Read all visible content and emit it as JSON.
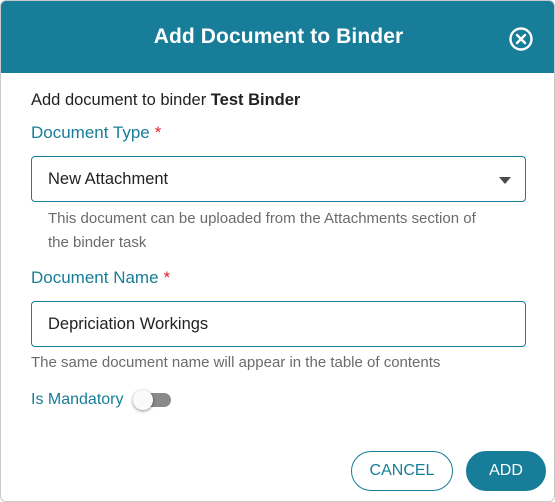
{
  "dialog": {
    "title": "Add Document to Binder",
    "intro_prefix": "Add document to binder ",
    "binder_name": "Test Binder"
  },
  "document_type": {
    "label": "Document Type",
    "required_marker": "*",
    "selected_value": "New Attachment",
    "hint": "This document can be uploaded from the Attachments section of the binder task"
  },
  "document_name": {
    "label": "Document Name",
    "required_marker": "*",
    "value": "Depriciation Workings",
    "hint": "The same document name will appear in the table of contents"
  },
  "mandatory": {
    "label": "Is Mandatory",
    "checked": false
  },
  "actions": {
    "cancel_label": "CANCEL",
    "add_label": "ADD"
  },
  "colors": {
    "accent": "#177d98",
    "required": "#d8262b"
  }
}
